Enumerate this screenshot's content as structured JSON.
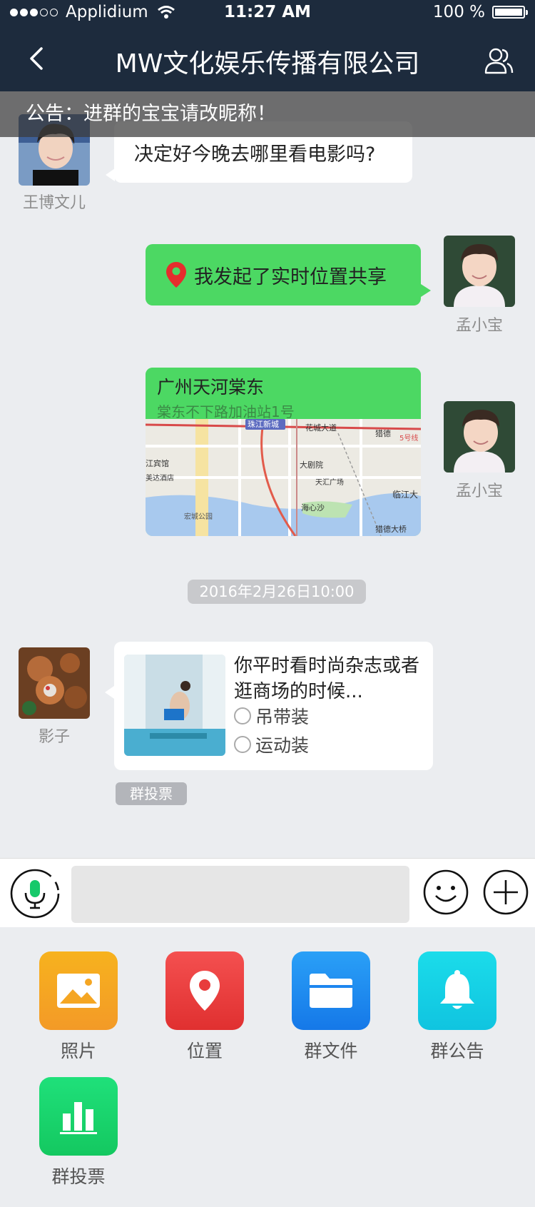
{
  "status_bar": {
    "carrier": "Applidium",
    "time": "11:27 AM",
    "battery": "100 %"
  },
  "nav": {
    "title": "MW文化娱乐传播有限公司"
  },
  "notice": {
    "text": "公告：进群的宝宝请改昵称！"
  },
  "messages": {
    "m1": {
      "sender": "王博文儿",
      "text": "决定好今晚去哪里看电影吗?"
    },
    "m2": {
      "sender": "孟小宝",
      "text": "我发起了实时位置共享"
    },
    "m3": {
      "sender": "孟小宝",
      "place": "广州天河棠东",
      "address": "棠东不下路加油站1号",
      "map_labels": [
        "珠江新城",
        "花城大道",
        "猎德",
        "5号线",
        "江宾馆",
        "大剧院",
        "美达酒店",
        "天汇广场",
        "临江大",
        "海心沙",
        "宏城公园",
        "猎德大桥"
      ]
    },
    "timestamp": "2016年2月26日10:00",
    "m4": {
      "sender": "影子",
      "question": "你平时看时尚杂志或者逛商场的时候...",
      "options": [
        "吊带装",
        "运动装"
      ],
      "tag": "群投票"
    }
  },
  "panel": {
    "items": [
      {
        "label": "照片",
        "icon": "photo-icon",
        "color": "#f6a623"
      },
      {
        "label": "位置",
        "icon": "location-icon",
        "color": "#ef3c3c"
      },
      {
        "label": "群文件",
        "icon": "folder-icon",
        "color": "#1f8ef2"
      },
      {
        "label": "群公告",
        "icon": "bell-icon",
        "color": "#16d3e6"
      },
      {
        "label": "群投票",
        "icon": "chart-icon",
        "color": "#1fd16a"
      }
    ]
  }
}
